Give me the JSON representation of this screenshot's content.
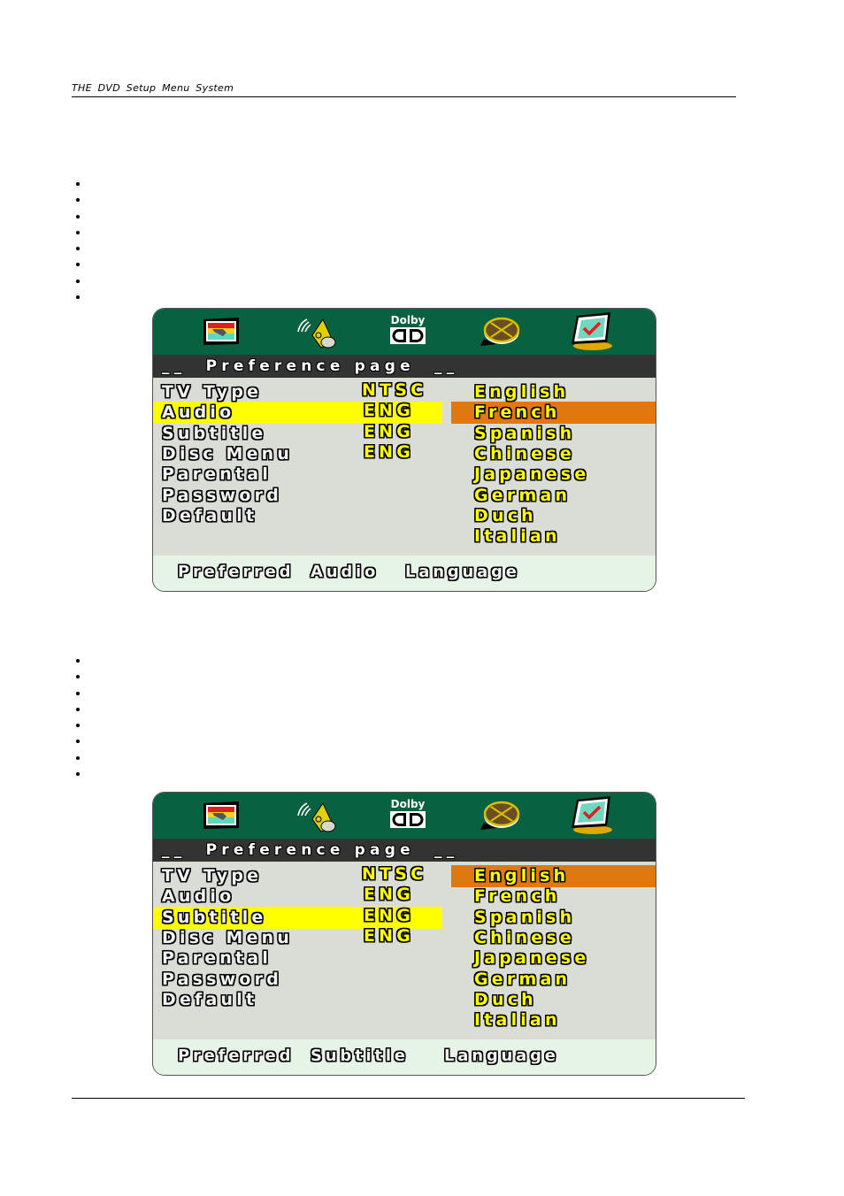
{
  "page": {
    "header": "THE DVD Setup Menu System",
    "bullet_lists": [
      {
        "count": 8
      },
      {
        "count": 8
      }
    ]
  },
  "colors": {
    "icon_bar": "#086140",
    "title_bar": "#333333",
    "content_bg": "#d9ddd6",
    "status_bg": "#e6f4e6",
    "highlight_row": "#ffff00",
    "highlight_option": "#e07810",
    "label_text": "#f2f2f2",
    "value_text": "#ffff00"
  },
  "icons": [
    "tv-setup-icon",
    "speaker-audio-icon",
    "dolby-icon",
    "film-reel-icon",
    "preference-monitor-icon"
  ],
  "dolby_label": "Dolby",
  "menus": [
    {
      "title": "__  Preference page  __",
      "items": [
        {
          "label": "TV Type",
          "value": "NTSC"
        },
        {
          "label": "Audio",
          "value": "ENG"
        },
        {
          "label": "Subtitle",
          "value": "ENG"
        },
        {
          "label": "Disc Menu",
          "value": "ENG"
        },
        {
          "label": "Parental",
          "value": ""
        },
        {
          "label": "Password",
          "value": ""
        },
        {
          "label": "Default",
          "value": ""
        }
      ],
      "selected_item": "Audio",
      "options": [
        "English",
        "French",
        "Spanish",
        "Chinese",
        "Japanese",
        "German",
        "Duch",
        "Italian"
      ],
      "highlighted_option": "French",
      "status": [
        "Preferred",
        "Audio",
        "Language"
      ]
    },
    {
      "title": "__  Preference page  __",
      "items": [
        {
          "label": "TV Type",
          "value": "NTSC"
        },
        {
          "label": "Audio",
          "value": "ENG"
        },
        {
          "label": "Subtitle",
          "value": "ENG"
        },
        {
          "label": "Disc Menu",
          "value": "ENG"
        },
        {
          "label": "Parental",
          "value": ""
        },
        {
          "label": "Password",
          "value": ""
        },
        {
          "label": "Default",
          "value": ""
        }
      ],
      "selected_item": "Subtitle",
      "options": [
        "English",
        "French",
        "Spanish",
        "Chinese",
        "Japanese",
        "German",
        "Duch",
        "Italian"
      ],
      "highlighted_option": "English",
      "status": [
        "Preferred",
        "Subtitle",
        "Language"
      ]
    }
  ]
}
